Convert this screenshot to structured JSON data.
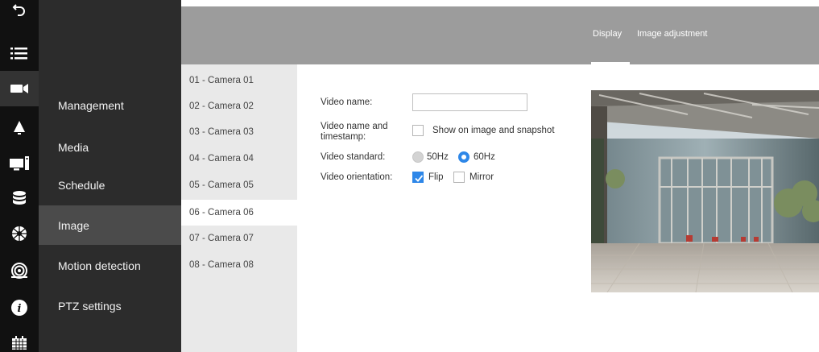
{
  "rail": {
    "items": [
      {
        "icon": "back-arrow-icon"
      },
      {
        "icon": "list-icon"
      },
      {
        "icon": "camera-icon",
        "active": true
      },
      {
        "icon": "bell-icon"
      },
      {
        "icon": "computer-icon"
      },
      {
        "icon": "storage-icon"
      },
      {
        "icon": "network-icon"
      },
      {
        "icon": "fisheye-lens-icon"
      },
      {
        "icon": "info-icon"
      },
      {
        "icon": "calendar-icon"
      }
    ]
  },
  "menu": {
    "items": [
      {
        "label": "Management"
      },
      {
        "label": "Media"
      },
      {
        "label": "Schedule"
      },
      {
        "label": "Image",
        "active": true
      },
      {
        "label": "Motion detection"
      },
      {
        "label": "PTZ settings"
      }
    ]
  },
  "header": {
    "tabs": [
      {
        "label": "Display",
        "active": true
      },
      {
        "label": "Image adjustment"
      }
    ]
  },
  "cameras": {
    "items": [
      {
        "label": "01 - Camera 01"
      },
      {
        "label": "02 - Camera 02"
      },
      {
        "label": "03 - Camera 03"
      },
      {
        "label": "04 - Camera 04"
      },
      {
        "label": "05 - Camera 05"
      },
      {
        "label": "06 - Camera 06",
        "active": true
      },
      {
        "label": "07 - Camera 07"
      },
      {
        "label": "08 - Camera 08"
      }
    ]
  },
  "form": {
    "video_name": {
      "label": "Video name:",
      "value": ""
    },
    "video_name_timestamp": {
      "label_line1": "Video name and",
      "label_line2": "timestamp:",
      "option_label": "Show on image and snapshot",
      "checked": false
    },
    "video_standard": {
      "label": "Video standard:",
      "options": [
        "50Hz",
        "60Hz"
      ],
      "selected": "60Hz"
    },
    "video_orientation": {
      "label": "Video orientation:",
      "flip_label": "Flip",
      "flip_checked": true,
      "mirror_label": "Mirror",
      "mirror_checked": false
    }
  },
  "colors": {
    "accent": "#2e87e8",
    "rail_bg": "#111111",
    "menu_bg": "#2c2c2c",
    "menu_active_bg": "#4b4b4b",
    "header_bg": "#9c9c9c",
    "camlist_bg": "#e9e9e9"
  }
}
